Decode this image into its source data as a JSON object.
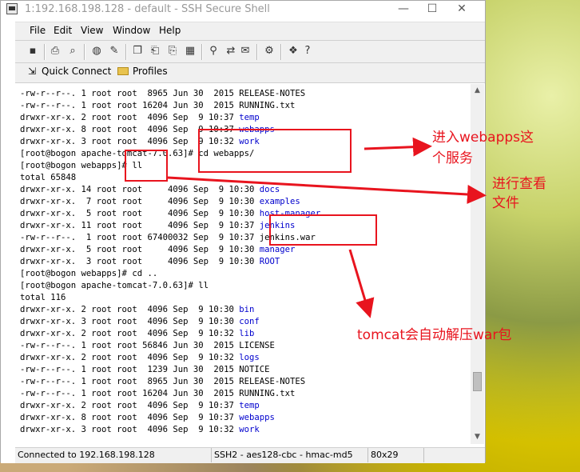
{
  "window": {
    "title": "1:192.168.198.128 - default - SSH Secure Shell",
    "controls": {
      "minimize": "—",
      "maximize": "☐",
      "close": "✕"
    }
  },
  "menu": [
    "File",
    "Edit",
    "View",
    "Window",
    "Help"
  ],
  "quick_bar": {
    "quick_connect": "Quick Connect",
    "profiles": "Profiles"
  },
  "terminal_lines": [
    {
      "prefix": "-rw-r--r--. 1 root root  8965 Jun 30  2015 ",
      "name": "RELEASE-NOTES",
      "dir": false
    },
    {
      "prefix": "-rw-r--r--. 1 root root 16204 Jun 30  2015 ",
      "name": "RUNNING.txt",
      "dir": false
    },
    {
      "prefix": "drwxr-xr-x. 2 root root  4096 Sep  9 10:37 ",
      "name": "temp",
      "dir": true
    },
    {
      "prefix": "drwxr-xr-x. 8 root root  4096 Sep  9 10:37 ",
      "name": "webapps",
      "dir": true
    },
    {
      "prefix": "drwxr-xr-x. 3 root root  4096 Sep  9 10:32 ",
      "name": "work",
      "dir": true
    },
    {
      "prefix": "[root@bogon apache-tomcat-7.0.63]# cd webapps/",
      "name": "",
      "dir": false
    },
    {
      "prefix": "[root@bogon webapps]# ll",
      "name": "",
      "dir": false
    },
    {
      "prefix": "total 65848",
      "name": "",
      "dir": false
    },
    {
      "prefix": "drwxr-xr-x. 14 root root     4096 Sep  9 10:30 ",
      "name": "docs",
      "dir": true
    },
    {
      "prefix": "drwxr-xr-x.  7 root root     4096 Sep  9 10:30 ",
      "name": "examples",
      "dir": true
    },
    {
      "prefix": "drwxr-xr-x.  5 root root     4096 Sep  9 10:30 ",
      "name": "host-manager",
      "dir": true
    },
    {
      "prefix": "drwxr-xr-x. 11 root root     4096 Sep  9 10:37 ",
      "name": "jenkins",
      "dir": true
    },
    {
      "prefix": "-rw-r--r--.  1 root root 67400032 Sep  9 10:37 ",
      "name": "jenkins.war",
      "dir": false
    },
    {
      "prefix": "drwxr-xr-x.  5 root root     4096 Sep  9 10:30 ",
      "name": "manager",
      "dir": true
    },
    {
      "prefix": "drwxr-xr-x.  3 root root     4096 Sep  9 10:30 ",
      "name": "ROOT",
      "dir": true
    },
    {
      "prefix": "[root@bogon webapps]# cd ..",
      "name": "",
      "dir": false
    },
    {
      "prefix": "[root@bogon apache-tomcat-7.0.63]# ll",
      "name": "",
      "dir": false
    },
    {
      "prefix": "total 116",
      "name": "",
      "dir": false
    },
    {
      "prefix": "drwxr-xr-x. 2 root root  4096 Sep  9 10:30 ",
      "name": "bin",
      "dir": true
    },
    {
      "prefix": "drwxr-xr-x. 3 root root  4096 Sep  9 10:30 ",
      "name": "conf",
      "dir": true
    },
    {
      "prefix": "drwxr-xr-x. 2 root root  4096 Sep  9 10:32 ",
      "name": "lib",
      "dir": true
    },
    {
      "prefix": "-rw-r--r--. 1 root root 56846 Jun 30  2015 ",
      "name": "LICENSE",
      "dir": false
    },
    {
      "prefix": "drwxr-xr-x. 2 root root  4096 Sep  9 10:32 ",
      "name": "logs",
      "dir": true
    },
    {
      "prefix": "-rw-r--r--. 1 root root  1239 Jun 30  2015 ",
      "name": "NOTICE",
      "dir": false
    },
    {
      "prefix": "-rw-r--r--. 1 root root  8965 Jun 30  2015 ",
      "name": "RELEASE-NOTES",
      "dir": false
    },
    {
      "prefix": "-rw-r--r--. 1 root root 16204 Jun 30  2015 ",
      "name": "RUNNING.txt",
      "dir": false
    },
    {
      "prefix": "drwxr-xr-x. 2 root root  4096 Sep  9 10:37 ",
      "name": "temp",
      "dir": true
    },
    {
      "prefix": "drwxr-xr-x. 8 root root  4096 Sep  9 10:37 ",
      "name": "webapps",
      "dir": true
    },
    {
      "prefix": "drwxr-xr-x. 3 root root  4096 Sep  9 10:32 ",
      "name": "work",
      "dir": true
    }
  ],
  "statusbar": {
    "connection": "Connected to 192.168.198.128",
    "cipher": "SSH2 - aes128-cbc - hmac-md5",
    "size": "80x29"
  },
  "annotations": {
    "enter_webapps": "进入webapps这\n个服务",
    "view_files": "进行查看\n文件",
    "tomcat_unzip": "tomcat会自动解压war包"
  },
  "colors": {
    "annotation": "#e8141e",
    "directory": "#0000cd"
  }
}
